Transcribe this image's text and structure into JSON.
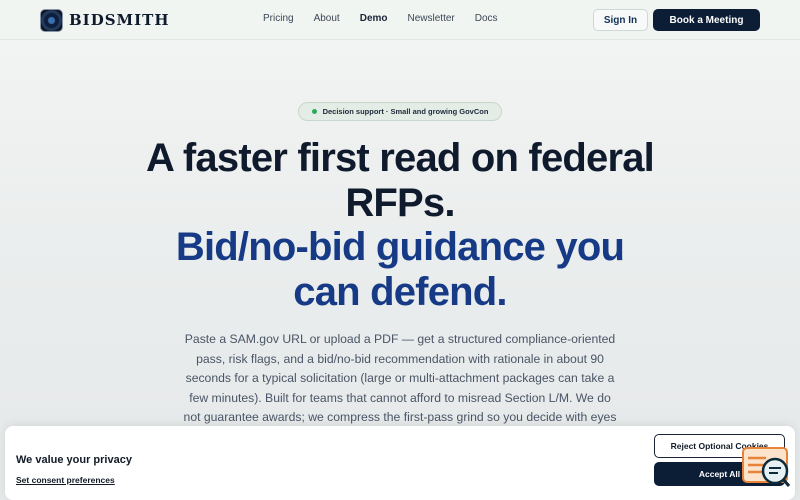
{
  "header": {
    "brand": "BIDSMITH",
    "nav": [
      "Pricing",
      "About",
      "Demo",
      "Newsletter",
      "Docs"
    ],
    "sign_in": "Sign In",
    "book_meeting": "Book a Meeting"
  },
  "hero": {
    "badge": "Decision support · Small and growing GovCon",
    "headline_line1": "A faster first read on federal",
    "headline_line2": "RFPs.",
    "headline_line3": "Bid/no-bid guidance you",
    "headline_line4": "can defend.",
    "description": "Paste a SAM.gov URL or upload a PDF — get a structured compliance-oriented pass, risk flags, and a bid/no-bid recommendation with rationale in about 90 seconds for a typical solicitation (large or multi-attachment packages can take a few minutes). Built for teams that cannot afford to misread Section L/M. We do not guarantee awards; we compress the first-pass grind so you decide with eyes"
  },
  "cookie": {
    "title": "We value your privacy",
    "preferences_link": "Set consent preferences",
    "reject_label": "Reject Optional Cookies",
    "accept_label": "Accept All"
  },
  "icons": {
    "logo": "bidsmith-logo-icon",
    "badge_dot": "status-dot-icon",
    "chat": "chat-support-icon"
  },
  "colors": {
    "navy": "#0c1d36",
    "headline_blue": "#163a86",
    "status_green": "#2fa85a",
    "chat_orange": "#e8833a"
  }
}
